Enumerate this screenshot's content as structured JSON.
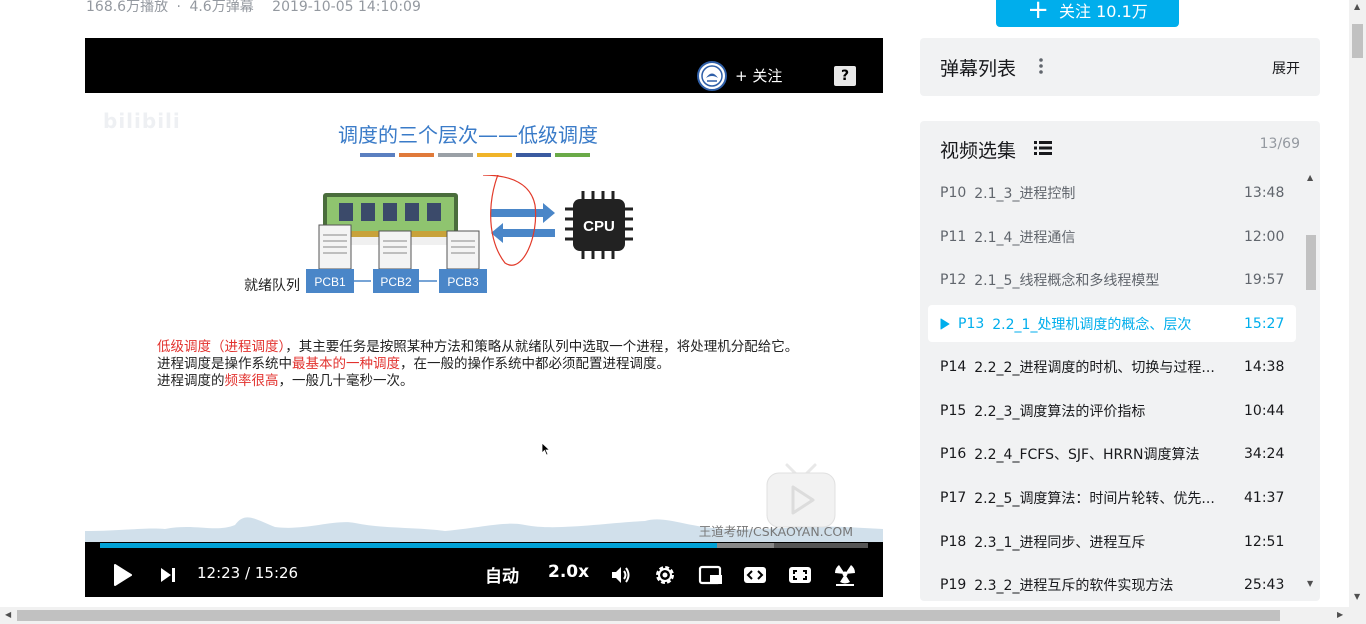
{
  "video_meta": {
    "plays": "168.6万播放",
    "dot": "·",
    "danmaku": "4.6万弹幕",
    "date": "2019-10-05 14:10:09"
  },
  "follow_button": {
    "plus": "+",
    "label": "关注 10.1万"
  },
  "player": {
    "up_follow": "+ 关注",
    "help": "?",
    "slide": {
      "title": "调度的三个层次——低级调度",
      "cpu_label": "CPU",
      "ready_queue_label": "就绪队列",
      "pcbs": [
        "PCB1",
        "PCB2",
        "PCB3"
      ],
      "watermark_logo": "bilibili",
      "watermark_bottom": "王道考研/CSKAOYAN.COM",
      "para1_red": "低级调度（进程调度）",
      "para1_rest": "，其主要任务是按照某种方法和策略从就绪队列中选取一个进程，将处理机分配给它。",
      "para2_a": "进程调度是操作系统中",
      "para2_red": "最基本的一种调度",
      "para2_b": "，在一般的操作系统中都必须配置进程调度。",
      "para3_a": "进程调度的",
      "para3_red": "频率很高",
      "para3_b": "，一般几十毫秒一次。",
      "bar_colors": [
        "#5b7fc0",
        "#e07a3a",
        "#9aa0a6",
        "#f0b429",
        "#3a5ba0",
        "#6aaa48"
      ]
    },
    "progress": {
      "played": 0.803,
      "buffered": 0.877
    },
    "time_current": "12:23",
    "time_sep": "/",
    "time_total": "15:26",
    "quality": "自动",
    "speed": "2.0x",
    "accent_color": "#00a1d6"
  },
  "danmaku_panel": {
    "title": "弹幕列表",
    "expand": "展开"
  },
  "episodes": {
    "title": "视频选集",
    "count": "13/69",
    "items": [
      {
        "p": "P10",
        "title": "2.1_3_进程控制",
        "duration": "13:48"
      },
      {
        "p": "P11",
        "title": "2.1_4_进程通信",
        "duration": "12:00"
      },
      {
        "p": "P12",
        "title": "2.1_5_线程概念和多线程模型",
        "duration": "19:57"
      },
      {
        "p": "P13",
        "title": "2.2_1_处理机调度的概念、层次",
        "duration": "15:27",
        "active": true
      },
      {
        "p": "P14",
        "title": "2.2_2_进程调度的时机、切换与过程...",
        "duration": "14:38"
      },
      {
        "p": "P15",
        "title": "2.2_3_调度算法的评价指标",
        "duration": "10:44"
      },
      {
        "p": "P16",
        "title": "2.2_4_FCFS、SJF、HRRN调度算法",
        "duration": "34:24"
      },
      {
        "p": "P17",
        "title": "2.2_5_调度算法：时间片轮转、优先...",
        "duration": "41:37"
      },
      {
        "p": "P18",
        "title": "2.3_1_进程同步、进程互斥",
        "duration": "12:51"
      },
      {
        "p": "P19",
        "title": "2.3_2_进程互斥的软件实现方法",
        "duration": "25:43"
      }
    ]
  }
}
